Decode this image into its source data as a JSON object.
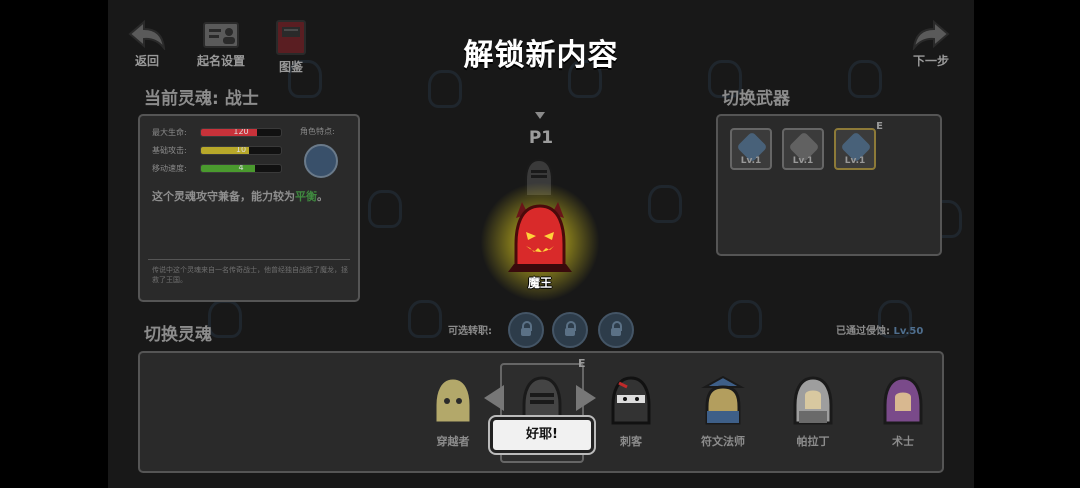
{
  "title": "解锁新内容",
  "topbar": {
    "back_label": "返回",
    "naming_label": "起名设置",
    "guide_label": "图鉴",
    "next_label": "下一步"
  },
  "current_soul": {
    "heading": "当前灵魂: 战士",
    "stats": [
      {
        "label": "最大生命:",
        "value": "120",
        "fill": 0.7,
        "color": "#c8323a"
      },
      {
        "label": "基础攻击:",
        "value": "10",
        "fill": 0.6,
        "color": "#b7a82a"
      },
      {
        "label": "移动速度:",
        "value": "4",
        "fill": 0.67,
        "color": "#4a9a2e"
      }
    ],
    "trait_label": "角色特点:",
    "desc_prefix": "这个灵魂攻守兼备，能力较为",
    "desc_highlight": "平衡",
    "desc_suffix": "。",
    "lore": "传说中这个灵魂来自一名传奇战士，他曾经独自战胜了魔龙，拯救了王国。"
  },
  "weapon": {
    "heading": "切换武器",
    "items": [
      {
        "level": "Lv.1",
        "color": "#4e6f8f"
      },
      {
        "level": "Lv.1",
        "color": "#6f6f6f"
      },
      {
        "level": "Lv.1",
        "color": "#4e6f8f"
      }
    ],
    "equipped_mark": "E"
  },
  "hero": {
    "player_tag": "P1",
    "unlocked_name": "魔王"
  },
  "souls": {
    "heading": "切换灵魂",
    "transfer_label": "可选转职:",
    "passed_prefix": "已通过侵蚀:",
    "passed_level": "Lv.50",
    "equipped_mark": "E",
    "characters": [
      {
        "name": "穿越者",
        "color": "#b3a86a"
      },
      {
        "name": "",
        "color": "#5a6b7a"
      },
      {
        "name": "刺客",
        "color": "#333333"
      },
      {
        "name": "符文法师",
        "color": "#5e7ea8"
      },
      {
        "name": "帕拉丁",
        "color": "#9e9e9e"
      },
      {
        "name": "术士",
        "color": "#7a4a8a"
      }
    ],
    "confirm_label": "好耶!"
  }
}
